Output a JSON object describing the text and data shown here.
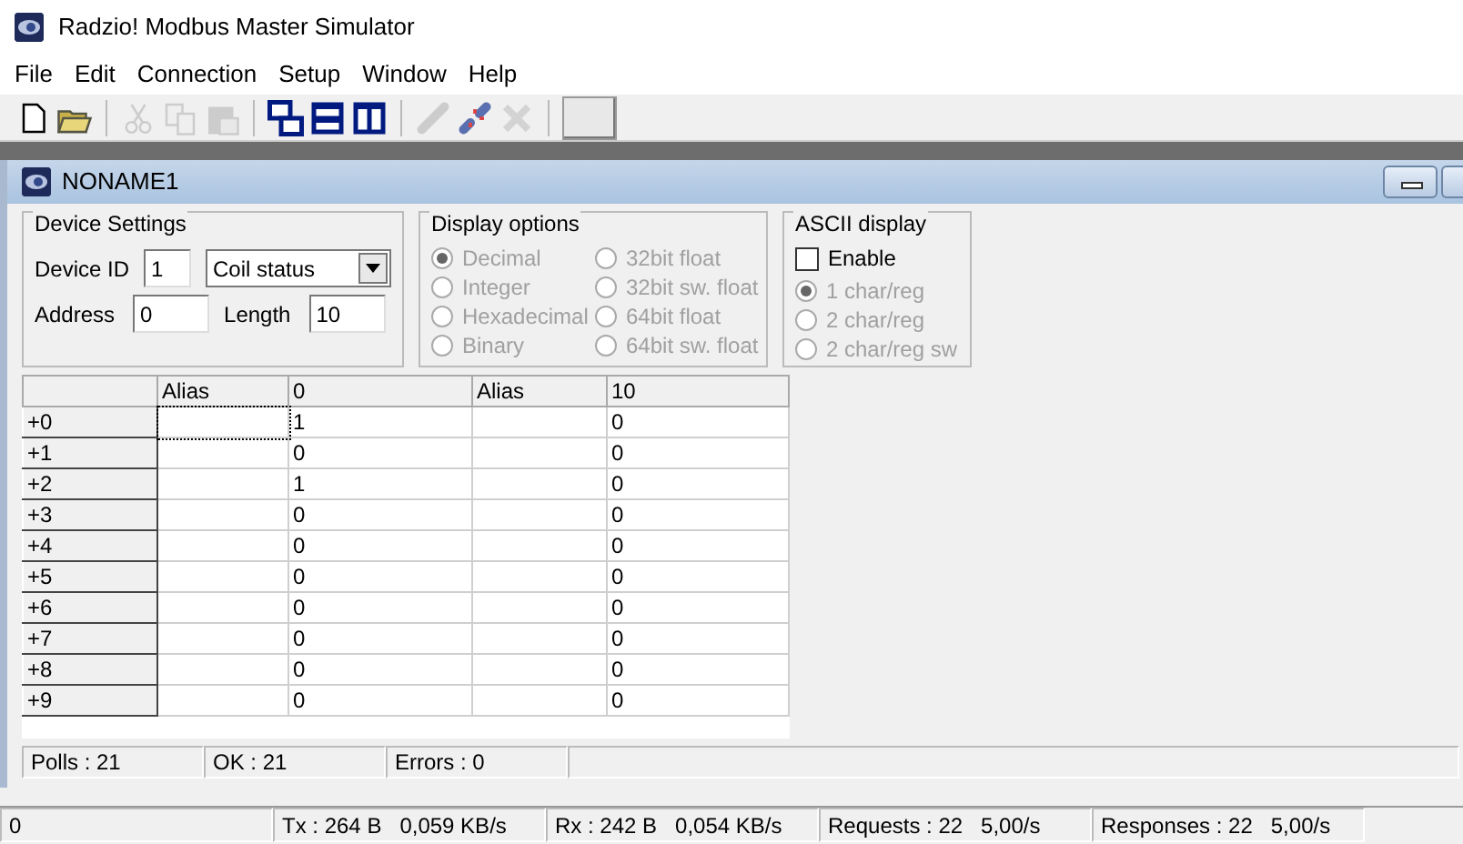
{
  "window": {
    "title": "Radzio! Modbus Master Simulator"
  },
  "menu": [
    "File",
    "Edit",
    "Connection",
    "Setup",
    "Window",
    "Help"
  ],
  "toolbar": [
    {
      "kind": "new",
      "disabled": false
    },
    {
      "kind": "open",
      "disabled": false
    },
    {
      "kind": "sep"
    },
    {
      "kind": "cut",
      "disabled": true
    },
    {
      "kind": "copy",
      "disabled": true
    },
    {
      "kind": "paste",
      "disabled": true
    },
    {
      "kind": "sep"
    },
    {
      "kind": "cascade",
      "disabled": false
    },
    {
      "kind": "htile",
      "disabled": false
    },
    {
      "kind": "vtile",
      "disabled": false
    },
    {
      "kind": "sep"
    },
    {
      "kind": "connect",
      "disabled": true
    },
    {
      "kind": "disconnect",
      "disabled": false
    },
    {
      "kind": "tools",
      "disabled": true
    },
    {
      "kind": "sep"
    },
    {
      "kind": "blank"
    }
  ],
  "child_window": {
    "title": "NONAME1"
  },
  "device_settings": {
    "title": "Device Settings",
    "device_id_label": "Device ID",
    "device_id": "1",
    "function": "Coil status",
    "address_label": "Address",
    "address": "0",
    "length_label": "Length",
    "length": "10"
  },
  "display_options": {
    "title": "Display options",
    "options": [
      {
        "label": "Decimal",
        "selected": true,
        "disabled": true
      },
      {
        "label": "32bit float",
        "selected": false,
        "disabled": true
      },
      {
        "label": "Integer",
        "selected": false,
        "disabled": true
      },
      {
        "label": "32bit sw. float",
        "selected": false,
        "disabled": true
      },
      {
        "label": "Hexadecimal",
        "selected": false,
        "disabled": true
      },
      {
        "label": "64bit float",
        "selected": false,
        "disabled": true
      },
      {
        "label": "Binary",
        "selected": false,
        "disabled": true
      },
      {
        "label": "64bit sw. float",
        "selected": false,
        "disabled": true
      }
    ]
  },
  "ascii_display": {
    "title": "ASCII display",
    "enable": {
      "label": "Enable",
      "checked": false
    },
    "options": [
      {
        "label": "1 char/reg",
        "selected": true,
        "disabled": true
      },
      {
        "label": "2 char/reg",
        "selected": false,
        "disabled": true
      },
      {
        "label": "2 char/reg sw",
        "selected": false,
        "disabled": true
      }
    ]
  },
  "table": {
    "columns": [
      "Alias",
      "0",
      "Alias",
      "10"
    ],
    "rows": [
      {
        "label": "+0",
        "values": [
          "1",
          "0"
        ]
      },
      {
        "label": "+1",
        "values": [
          "0",
          "0"
        ]
      },
      {
        "label": "+2",
        "values": [
          "1",
          "0"
        ]
      },
      {
        "label": "+3",
        "values": [
          "0",
          "0"
        ]
      },
      {
        "label": "+4",
        "values": [
          "0",
          "0"
        ]
      },
      {
        "label": "+5",
        "values": [
          "0",
          "0"
        ]
      },
      {
        "label": "+6",
        "values": [
          "0",
          "0"
        ]
      },
      {
        "label": "+7",
        "values": [
          "0",
          "0"
        ]
      },
      {
        "label": "+8",
        "values": [
          "0",
          "0"
        ]
      },
      {
        "label": "+9",
        "values": [
          "0",
          "0"
        ]
      }
    ]
  },
  "child_status": [
    "Polls : 21",
    "OK : 21",
    "Errors : 0"
  ],
  "status_bar": [
    {
      "text": "0"
    },
    {
      "text": "Tx : 264 B",
      "rate": "0,059 KB/s"
    },
    {
      "text": "Rx : 242 B",
      "rate": "0,054 KB/s"
    },
    {
      "text": "Requests : 22",
      "rate": "5,00/s"
    },
    {
      "text": "Responses : 22",
      "rate": "5,00/s"
    }
  ]
}
